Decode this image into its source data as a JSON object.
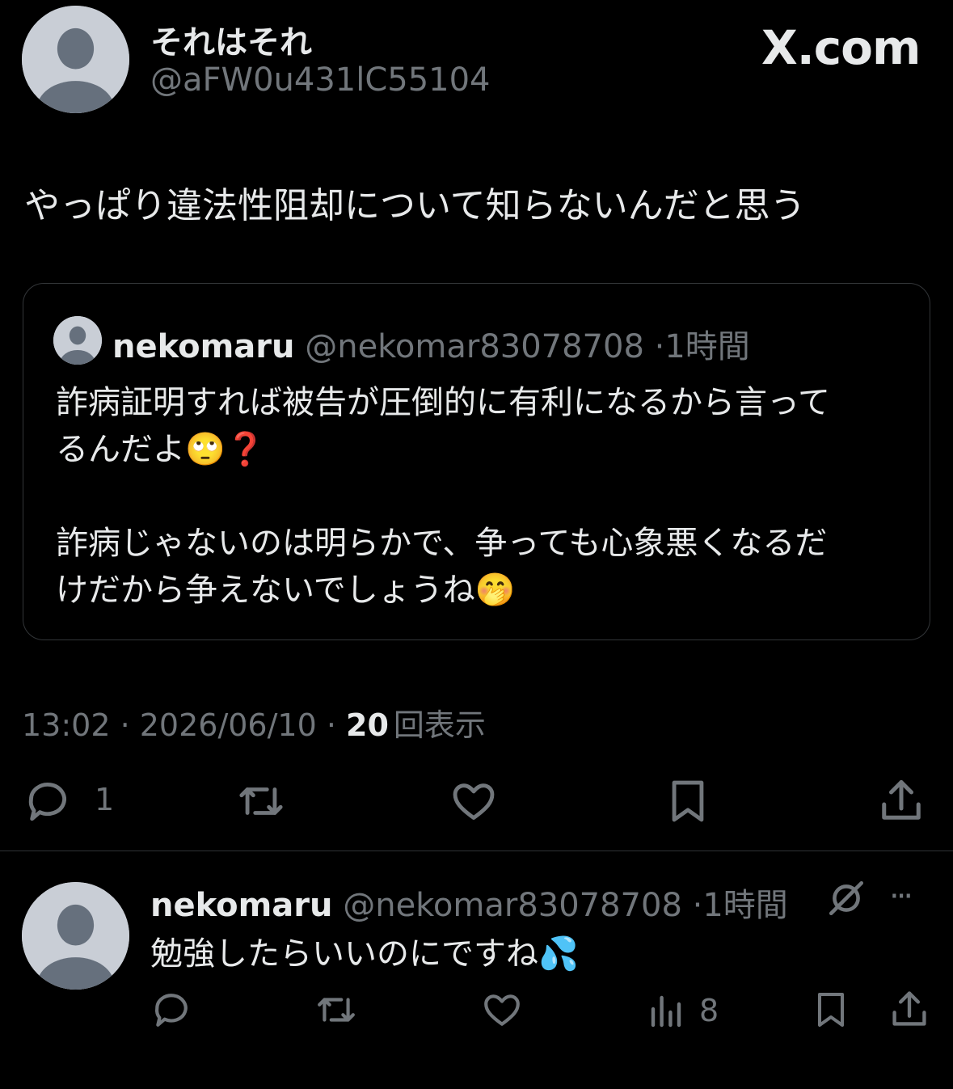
{
  "main_tweet": {
    "display_name": "それはそれ",
    "handle": "@aFW0u431lC55104",
    "text": "やっぱり違法性阻却について知らないんだと思う",
    "brand": "X.com",
    "timestamp": "13:02 · 2026/06/10 · ",
    "view_count": "20",
    "view_label": "回表示",
    "reply_count": "1"
  },
  "quote": {
    "display_name": "nekomaru",
    "handle": "@nekomar83078708",
    "time": "·1時間",
    "para1_line1": "詐病証明すれば被告が圧倒的に有利になるから言って",
    "para1_line2": "るんだよ",
    "emoji1": "🙄",
    "emoji2": "❓",
    "para2_line1": "詐病じゃないのは明らかで、争っても心象悪くなるだ",
    "para2_line2": "けだから争えないでしょうね",
    "emoji3": "🤭"
  },
  "reply": {
    "display_name": "nekomaru",
    "handle": "@nekomar83078708",
    "time": "·1時間",
    "text": "勉強したらいいのにですね",
    "emoji": "💦",
    "views_count": "8",
    "more_label": "···"
  },
  "icons": [
    "default-avatar-icon",
    "reply-icon",
    "retweet-icon",
    "like-icon",
    "bookmark-icon",
    "share-icon",
    "views-icon",
    "grok-icon",
    "more-icon"
  ],
  "colors": {
    "background": "#000000",
    "text": "#e7e9ea",
    "muted": "#71767b",
    "border": "#2f3336"
  }
}
